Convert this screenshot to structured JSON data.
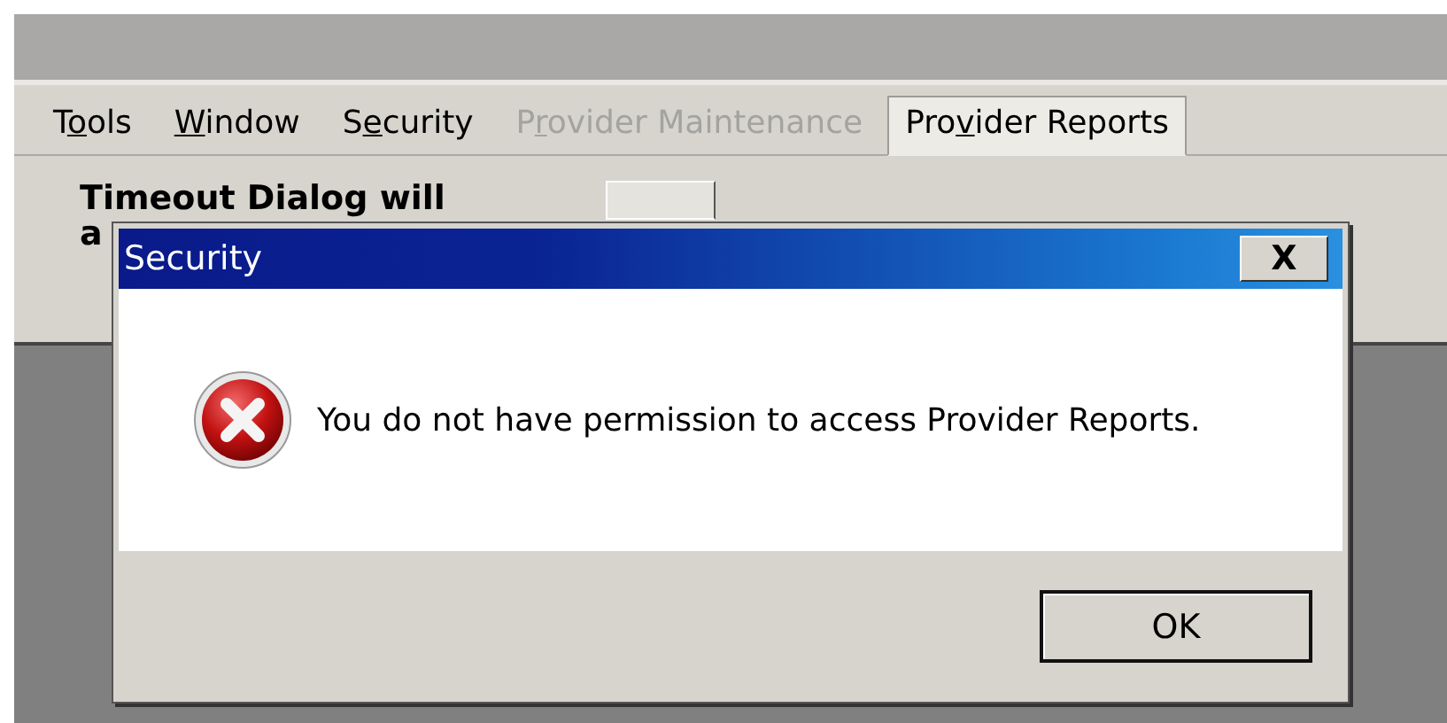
{
  "menu": [
    {
      "before": "T",
      "mnemonic": "o",
      "after": "ols",
      "disabled": false,
      "selected": false
    },
    {
      "mnemonic": "W",
      "after": "indow",
      "disabled": false,
      "selected": false
    },
    {
      "before": "S",
      "mnemonic": "e",
      "after": "curity",
      "disabled": false,
      "selected": false
    },
    {
      "before": "P",
      "mnemonic": "r",
      "after": "ovider Maintenance",
      "disabled": true,
      "selected": false
    },
    {
      "before": "Pro",
      "mnemonic": "v",
      "after": "ider Reports",
      "disabled": false,
      "selected": true
    }
  ],
  "panel": {
    "label_line_1": "Timeout Dialog will",
    "label_line_2": "a"
  },
  "dialog": {
    "title": "Security",
    "close": "X",
    "message": "You do not have permission to access Provider Reports.",
    "kind": "error",
    "buttons": [
      "OK"
    ]
  }
}
